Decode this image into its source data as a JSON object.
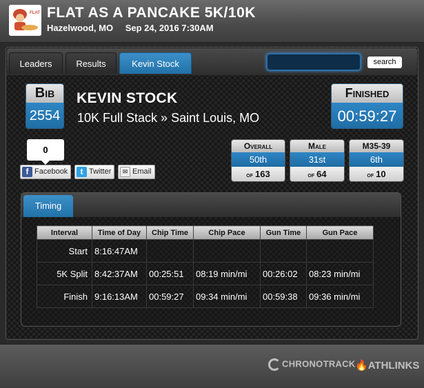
{
  "event": {
    "title": "FLAT AS A PANCAKE 5K/10K",
    "location": "Hazelwood, MO",
    "datetime": "Sep 24, 2016 7:30AM"
  },
  "tabs": [
    {
      "label": "Leaders",
      "active": false
    },
    {
      "label": "Results",
      "active": false
    },
    {
      "label": "Kevin Stock",
      "active": true
    }
  ],
  "search": {
    "placeholder": "",
    "value": "",
    "button_label": "search"
  },
  "bib": {
    "label": "Bib",
    "number": "2554"
  },
  "runner": {
    "name": "KEVIN STOCK",
    "race": "10K Full Stack » Saint Louis, MO"
  },
  "finished": {
    "label": "Finished",
    "time": "00:59:27"
  },
  "share": {
    "count": "0",
    "facebook": "Facebook",
    "twitter": "Twitter",
    "email": "Email"
  },
  "ranks": [
    {
      "title": "Overall",
      "place": "50th",
      "of_label": "of",
      "total": "163"
    },
    {
      "title": "Male",
      "place": "31st",
      "of_label": "of",
      "total": "64"
    },
    {
      "title": "M35-39",
      "place": "6th",
      "of_label": "of",
      "total": "10"
    }
  ],
  "timing": {
    "tab_label": "Timing",
    "columns": [
      "Interval",
      "Time of Day",
      "Chip Time",
      "Chip Pace",
      "Gun Time",
      "Gun Pace"
    ],
    "rows": [
      [
        "Start",
        "8:16:47AM",
        "",
        "",
        "",
        ""
      ],
      [
        "5K Split",
        "8:42:37AM",
        "00:25:51",
        "08:19 min/mi",
        "00:26:02",
        "08:23 min/mi"
      ],
      [
        "Finish",
        "9:16:13AM",
        "00:59:27",
        "09:34 min/mi",
        "00:59:38",
        "09:36 min/mi"
      ]
    ]
  },
  "footer": {
    "chronotrack": "CHRONOTRACK",
    "athlinks": "ATHLINKS"
  },
  "colors": {
    "accent": "#2172a8",
    "background": "#161616"
  }
}
